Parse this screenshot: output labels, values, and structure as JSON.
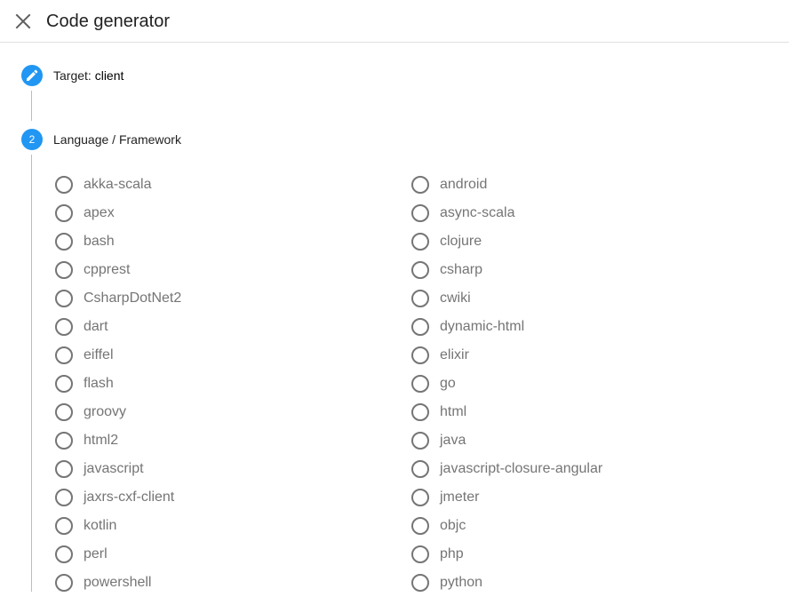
{
  "header": {
    "title": "Code generator",
    "close_icon": "close-icon"
  },
  "steps": {
    "target": {
      "label": "Target:",
      "value": "client",
      "icon": "pencil-icon"
    },
    "language": {
      "number": "2",
      "label": "Language / Framework"
    }
  },
  "options": {
    "left": [
      "akka-scala",
      "apex",
      "bash",
      "cpprest",
      "CsharpDotNet2",
      "dart",
      "eiffel",
      "flash",
      "groovy",
      "html2",
      "javascript",
      "jaxrs-cxf-client",
      "kotlin",
      "perl",
      "powershell"
    ],
    "right": [
      "android",
      "async-scala",
      "clojure",
      "csharp",
      "cwiki",
      "dynamic-html",
      "elixir",
      "go",
      "html",
      "java",
      "javascript-closure-angular",
      "jmeter",
      "objc",
      "php",
      "python"
    ]
  },
  "colors": {
    "accent": "#2196f3",
    "radio_border": "#757575",
    "label_text": "#757575",
    "divider": "#e0e0e0"
  }
}
